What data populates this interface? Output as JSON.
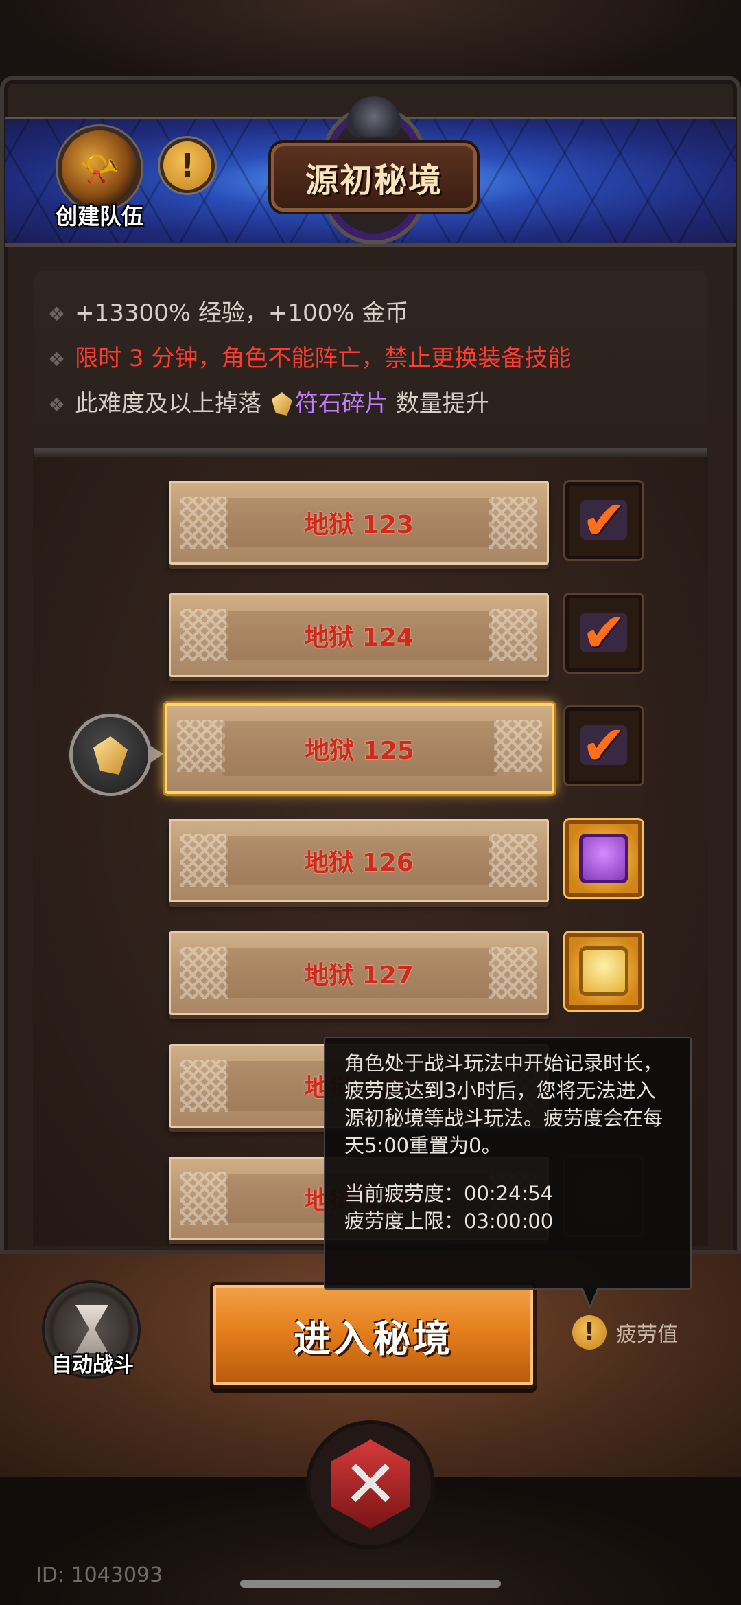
{
  "header": {
    "team_label": "创建队伍",
    "title": "源初秘境",
    "info_glyph": "!"
  },
  "buffs": {
    "line1": "+13300% 经验，+100% 金币",
    "line2": "限时 3 分钟，角色不能阵亡，禁止更换装备技能",
    "line3_prefix": "此难度及以上掉落",
    "line3_item": "符石碎片",
    "line3_suffix": "数量提升",
    "bullet_glyph": "❖"
  },
  "levels": [
    {
      "label": "地狱 123",
      "reward": "claimed"
    },
    {
      "label": "地狱 124",
      "reward": "claimed"
    },
    {
      "label": "地狱 125",
      "reward": "claimed",
      "selected": true
    },
    {
      "label": "地狱 126",
      "reward": "purple-chest"
    },
    {
      "label": "地狱 127",
      "reward": "gold-chest"
    },
    {
      "label": "地狱 128",
      "reward": "hidden"
    },
    {
      "label": "地狱 129",
      "reward": "faded-chest"
    }
  ],
  "check_glyph": "✔",
  "tooltip": {
    "description": "角色处于战斗玩法中开始记录时长，疲劳度达到3小时后，您将无法进入源初秘境等战斗玩法。疲劳度会在每天5:00重置为0。",
    "current_label": "当前疲劳度：",
    "current_value": "00:24:54",
    "limit_label": "疲劳度上限：",
    "limit_value": "03:00:00"
  },
  "controls": {
    "auto_battle_label": "自动战斗",
    "enter_label": "进入秘境",
    "fatigue_label": "疲劳值",
    "fatigue_glyph": "!",
    "close_glyph": "✕"
  },
  "footer": {
    "player_id": "ID: 1043093"
  },
  "colors": {
    "accent_orange": "#e57f1c",
    "level_text_red": "#d2281e",
    "warning_red": "#ff3b2f",
    "item_purple": "#c07bff"
  }
}
